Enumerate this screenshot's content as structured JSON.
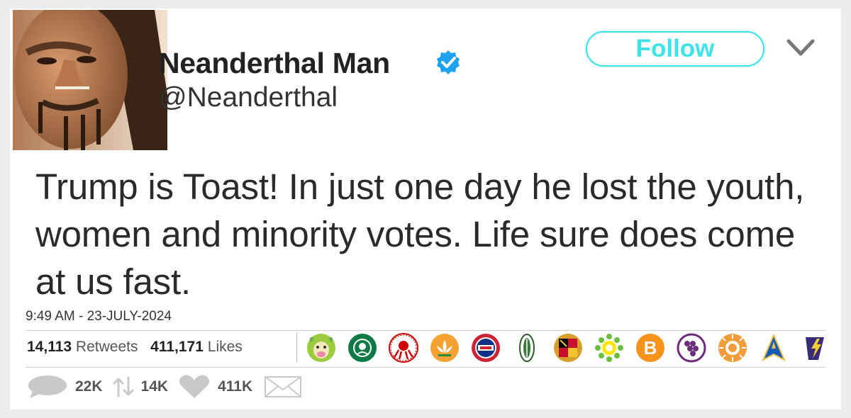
{
  "user": {
    "display_name": "Neanderthal Man",
    "handle": "@Neanderthal",
    "verified": true
  },
  "header": {
    "follow_label": "Follow"
  },
  "tweet": {
    "text": "Trump is Toast! In just one day he lost the youth, women and minority votes. Life sure does come at us fast.",
    "timestamp": "9:49 AM - 23-JULY-2024"
  },
  "stats": {
    "retweets_count": "14,113",
    "retweets_label": "Retweets",
    "likes_count": "411,171",
    "likes_label": "Likes"
  },
  "liker_badges": [
    {
      "icon": "cow-icon"
    },
    {
      "icon": "starbucks-icon"
    },
    {
      "icon": "hydra-icon"
    },
    {
      "icon": "lotus-icon"
    },
    {
      "icon": "cubs-icon"
    },
    {
      "icon": "seed-icon"
    },
    {
      "icon": "maryland-flag-icon"
    },
    {
      "icon": "bp-sunflower-icon"
    },
    {
      "icon": "bitcoin-icon",
      "text": "B"
    },
    {
      "icon": "grapes-icon"
    },
    {
      "icon": "sun-icon"
    },
    {
      "icon": "starfleet-icon"
    },
    {
      "icon": "lightning-flag-icon"
    }
  ],
  "actions": {
    "reply_count": "22K",
    "retweet_count": "14K",
    "like_count": "411K"
  },
  "colors": {
    "follow_accent": "#3ee3ea",
    "verified_blue": "#1da1f2",
    "action_gray": "#c9c9c9"
  }
}
